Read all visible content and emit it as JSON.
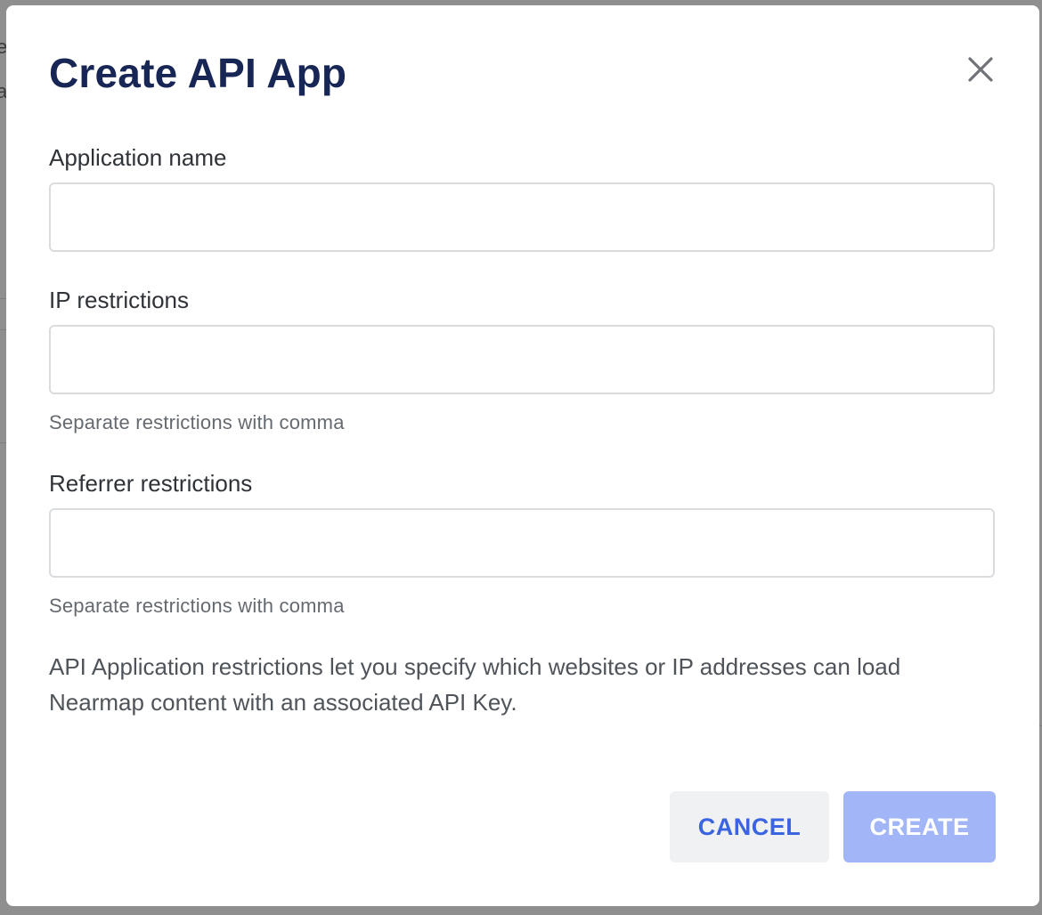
{
  "background": {
    "fragment_1": "e",
    "fragment_2": "a"
  },
  "modal": {
    "title": "Create API App",
    "close_icon": "close-icon",
    "fields": [
      {
        "label": "Application name",
        "value": "",
        "placeholder": "",
        "helper": ""
      },
      {
        "label": "IP restrictions",
        "value": "",
        "placeholder": "",
        "helper": "Separate restrictions with comma"
      },
      {
        "label": "Referrer restrictions",
        "value": "",
        "placeholder": "",
        "helper": "Separate restrictions with comma"
      }
    ],
    "description": "API Application restrictions let you specify which websites or IP addresses can load Nearmap content with an associated API Key.",
    "buttons": {
      "cancel_label": "CANCEL",
      "create_label": "CREATE"
    }
  },
  "colors": {
    "title": "#172654",
    "accent": "#3b64e0",
    "create_disabled_bg": "#a2b6f7",
    "overlay": "#8f8f8f"
  }
}
